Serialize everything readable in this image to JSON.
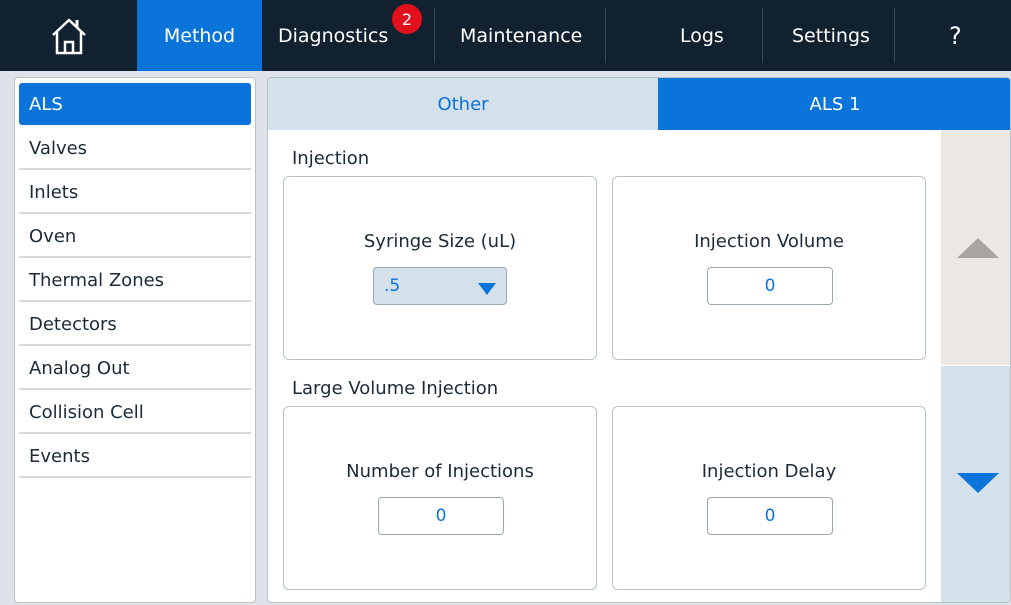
{
  "topnav": {
    "home_icon": "home-icon",
    "method": "Method",
    "diagnostics": "Diagnostics",
    "diagnostics_badge": "2",
    "maintenance": "Maintenance",
    "logs": "Logs",
    "settings": "Settings",
    "help": "?"
  },
  "sidebar": {
    "items": [
      {
        "label": "ALS",
        "active": true
      },
      {
        "label": "Valves"
      },
      {
        "label": "Inlets"
      },
      {
        "label": "Oven"
      },
      {
        "label": "Thermal Zones"
      },
      {
        "label": "Detectors"
      },
      {
        "label": "Analog Out"
      },
      {
        "label": "Collision Cell"
      },
      {
        "label": "Events"
      }
    ]
  },
  "tabs": {
    "other": "Other",
    "als1": "ALS 1"
  },
  "injection": {
    "section_label": "Injection",
    "syringe_size_label": "Syringe Size (uL)",
    "syringe_size_value": ".5",
    "injection_volume_label": "Injection Volume",
    "injection_volume_value": "0"
  },
  "large_volume": {
    "section_label": "Large Volume Injection",
    "num_injections_label": "Number of Injections",
    "num_injections_value": "0",
    "injection_delay_label": "Injection Delay",
    "injection_delay_value": "0"
  },
  "colors": {
    "accent": "#0a74da",
    "topbar": "#12212f",
    "badge": "#e0101d"
  }
}
